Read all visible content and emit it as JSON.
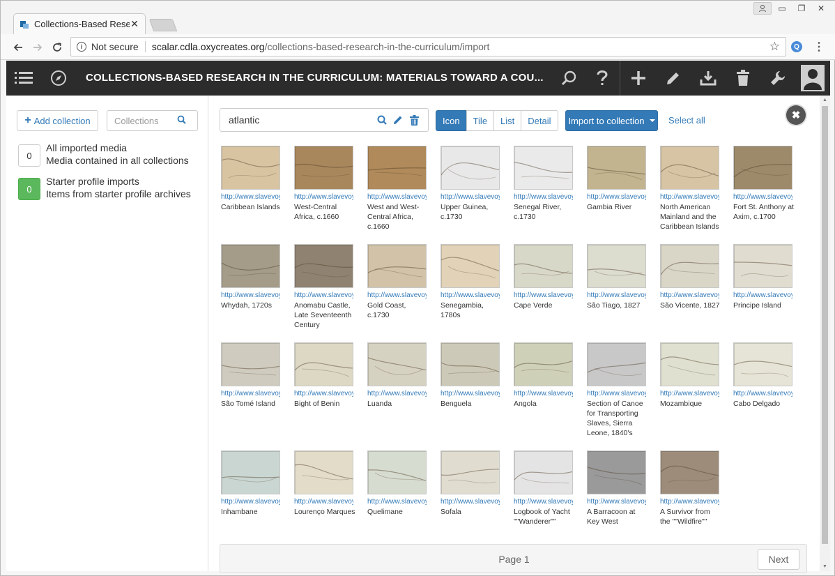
{
  "browser": {
    "tab_title": "Collections-Based Resear",
    "omnibox_security": "Not secure",
    "url_host": "scalar.cdla.oxycreates.org",
    "url_path": "/collections-based-research-in-the-curriculum/import"
  },
  "header": {
    "title": "COLLECTIONS-BASED RESEARCH IN THE CURRICULUM: MATERIALS TOWARD A COU..."
  },
  "sidebar": {
    "add_collection": "Add collection",
    "search_placeholder": "Collections",
    "items": [
      {
        "count": "0",
        "title": "All imported media",
        "subtitle": "Media contained in all collections"
      },
      {
        "count": "0",
        "title": "Starter profile imports",
        "subtitle": "Items from starter profile archives"
      }
    ]
  },
  "main": {
    "search_value": "atlantic",
    "views": [
      "Icon",
      "Tile",
      "List",
      "Detail"
    ],
    "active_view": "Icon",
    "import_button": "Import to collection",
    "select_all": "Select all",
    "close": "✖",
    "url_prefix": "http://www.slavevoy",
    "items": [
      {
        "title": "Caribbean Islands",
        "tone": "#d9c4a2"
      },
      {
        "title": "West-Central Africa, c.1660",
        "tone": "#a8875c"
      },
      {
        "title": "West and West-Central Africa, c.1660",
        "tone": "#b08a5a"
      },
      {
        "title": "Upper Guinea, c.1730",
        "tone": "#e8e8e8"
      },
      {
        "title": "Senegal River, c.1730",
        "tone": "#eaeaea"
      },
      {
        "title": "Gambia River",
        "tone": "#c2b48f"
      },
      {
        "title": "North American Mainland and the Caribbean Islands",
        "tone": "#d6c4a4"
      },
      {
        "title": "Fort St. Anthony at Axim, c.1700",
        "tone": "#9c8a6a"
      },
      {
        "title": "Whydah, 1720s",
        "tone": "#a49c88"
      },
      {
        "title": "Anomabu Castle, Late Seventeenth Century",
        "tone": "#8f8270"
      },
      {
        "title": "Gold Coast, c.1730",
        "tone": "#d2c3a8"
      },
      {
        "title": "Senegambia, 1780s",
        "tone": "#e2d3b8"
      },
      {
        "title": "Cape Verde",
        "tone": "#d8d8c8"
      },
      {
        "title": "São Tiago, 1827",
        "tone": "#dcdccf"
      },
      {
        "title": "São Vicente, 1827",
        "tone": "#d9d6c8"
      },
      {
        "title": "Principe Island",
        "tone": "#e0ddd0"
      },
      {
        "title": "São Tomé Island",
        "tone": "#cfccbf"
      },
      {
        "title": "Bight of Benin",
        "tone": "#dcd8c3"
      },
      {
        "title": "Luanda",
        "tone": "#d6d2c2"
      },
      {
        "title": "Benguela",
        "tone": "#cdc9b8"
      },
      {
        "title": "Angola",
        "tone": "#cfd0b8"
      },
      {
        "title": "Section of Canoe for Transporting Slaves, Sierra Leone, 1840's",
        "tone": "#c8c8c8"
      },
      {
        "title": "Mozambique",
        "tone": "#dfe0d0"
      },
      {
        "title": "Cabo Delgado",
        "tone": "#e6e4d6"
      },
      {
        "title": "Inhambane",
        "tone": "#c9d6d2"
      },
      {
        "title": "Lourenço Marques",
        "tone": "#e3dcc8"
      },
      {
        "title": "Quelimane",
        "tone": "#d6dccf"
      },
      {
        "title": "Sofala",
        "tone": "#e0ddd0"
      },
      {
        "title": "Logbook of Yacht \"\"Wanderer\"\"",
        "tone": "#e4e4e4"
      },
      {
        "title": "A Barracoon at Key West",
        "tone": "#9a9a9a"
      },
      {
        "title": "A Survivor from the \"\"Wildfire\"\"",
        "tone": "#9d8c7a"
      }
    ]
  },
  "pager": {
    "label": "Page 1",
    "next": "Next"
  },
  "colors": {
    "accent": "#337ab7",
    "header_bg": "#2c2c2c",
    "green": "#5cb85c"
  }
}
